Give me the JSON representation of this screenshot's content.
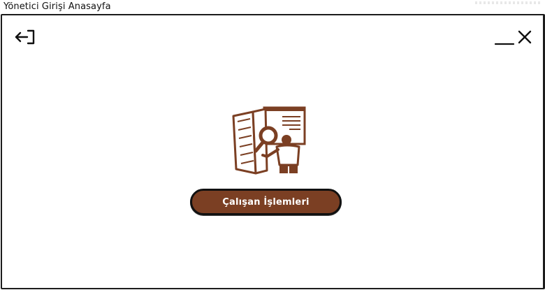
{
  "window": {
    "title": "Yönetici Girişi Anasayfa"
  },
  "icons": {
    "back": "logout-arrow-icon",
    "minimize": "minimize-icon",
    "close": "close-icon",
    "illustration": "person-with-magnifier-and-book-illustration"
  },
  "main": {
    "employee_button_label": "Çalışan İşlemleri"
  },
  "colors": {
    "accent": "#7b3f23",
    "border": "#1c1c1c",
    "background": "#ffffff",
    "button_text": "#ffffff"
  }
}
